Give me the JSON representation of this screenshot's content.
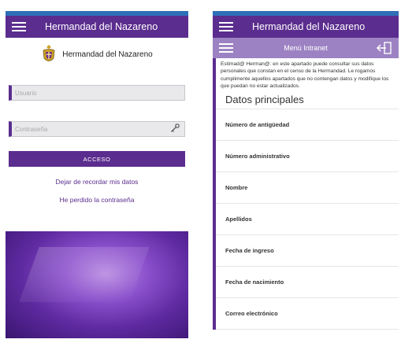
{
  "login_screen": {
    "app_title": "Hermandad del Nazareno",
    "brand_name": "Hermandad del Nazareno",
    "username_placeholder": "Usuario",
    "password_placeholder": "Contraseña",
    "access_button": "ACCESO",
    "forget_link": "Dejar de recordar mis datos",
    "lost_password_link": "He perdido la contraseña"
  },
  "intranet_screen": {
    "app_title": "Hermandad del Nazareno",
    "menu_title": "Menú Intranet",
    "intro_text": "Estimad@ Herman@: en este apartado puede consultar sus datos personales que constan en el censo de la Hermandad. Le rogamos cumplimente aquellos apartados que no contengan datos y modifique los que puedan no estar actualizados.",
    "section_title": "Datos principales",
    "fields": [
      "Número de antigüedad",
      "Número administrativo",
      "Nombre",
      "Apellidos",
      "Fecha de ingreso",
      "Fecha de nacimiento",
      "Correo electrónico"
    ]
  },
  "colors": {
    "primary": "#5b2d8e",
    "secondary_bar": "#9c82c2",
    "status_bar": "#2f6fb8"
  },
  "icons": [
    "menu-icon",
    "crest-icon",
    "key-icon",
    "exit-icon"
  ]
}
